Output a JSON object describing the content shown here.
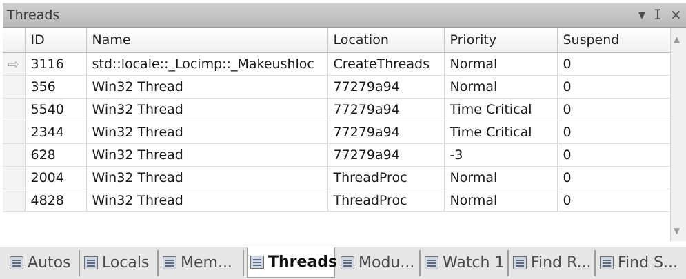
{
  "panel": {
    "title": "Threads",
    "dropdown_glyph": "▾",
    "pin_glyph": "ⵊ",
    "close_glyph": "×"
  },
  "grid": {
    "columns": [
      "ID",
      "Name",
      "Location",
      "Priority",
      "Suspend"
    ],
    "current_row_indicator": "⇨",
    "rows": [
      {
        "id": "3116",
        "name": "std::locale::_Locimp::_Makeushloc",
        "location": "CreateThreads",
        "priority": "Normal",
        "suspend": "0"
      },
      {
        "id": "356",
        "name": "Win32 Thread",
        "location": "77279a94",
        "priority": "Normal",
        "suspend": "0"
      },
      {
        "id": "5540",
        "name": "Win32 Thread",
        "location": "77279a94",
        "priority": "Time Critical",
        "suspend": "0"
      },
      {
        "id": "2344",
        "name": "Win32 Thread",
        "location": "77279a94",
        "priority": "Time Critical",
        "suspend": "0"
      },
      {
        "id": "628",
        "name": "Win32 Thread",
        "location": "77279a94",
        "priority": "-3",
        "suspend": "0"
      },
      {
        "id": "2004",
        "name": "Win32 Thread",
        "location": "ThreadProc",
        "priority": "Normal",
        "suspend": "0"
      },
      {
        "id": "4828",
        "name": "Win32 Thread",
        "location": "ThreadProc",
        "priority": "Normal",
        "suspend": "0"
      }
    ]
  },
  "scrollbar": {
    "up_glyph": "▲",
    "down_glyph": "▼"
  },
  "tabs": [
    {
      "label": "Autos",
      "icon": "autos-icon"
    },
    {
      "label": "Locals",
      "icon": "locals-icon"
    },
    {
      "label": "Mem...",
      "icon": "memory-icon"
    },
    {
      "label": "Threads",
      "icon": "threads-icon",
      "active": true
    },
    {
      "label": "Modu...",
      "icon": "modules-icon"
    },
    {
      "label": "Watch 1",
      "icon": "watch-icon"
    },
    {
      "label": "Find R...",
      "icon": "find-results-icon"
    },
    {
      "label": "Find S...",
      "icon": "find-symbol-icon"
    }
  ]
}
